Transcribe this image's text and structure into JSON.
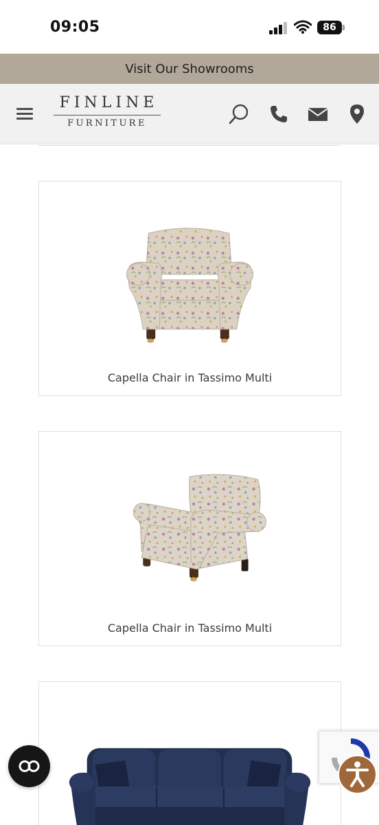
{
  "status_bar": {
    "time": "09:05",
    "battery": "86",
    "icons": [
      "signal-icon",
      "wifi-icon",
      "battery-icon"
    ]
  },
  "banner": {
    "text": "Visit Our Showrooms"
  },
  "header": {
    "logo_top": "FINLINE",
    "logo_bottom": "FURNITURE",
    "icons": [
      "menu-icon",
      "search-icon",
      "phone-icon",
      "email-icon",
      "location-icon"
    ]
  },
  "products": [
    {
      "name": "Capella Chair in Tassimo Multi",
      "image": "floral-armchair-front"
    },
    {
      "name": "Capella Chair in Tassimo Multi",
      "image": "floral-armchair-angled"
    },
    {
      "name": "",
      "image": "navy-velvet-sofa"
    }
  ],
  "floating": {
    "chat_icon": "co-chat-icon",
    "recaptcha_icon": "recaptcha-icon",
    "accessibility_icon": "accessibility-icon"
  },
  "colors": {
    "banner_bg": "#b2a899",
    "header_bg": "#f1f1f1",
    "accessibility_bg": "#a0683a",
    "sofa_navy": "#1f2a4a"
  }
}
